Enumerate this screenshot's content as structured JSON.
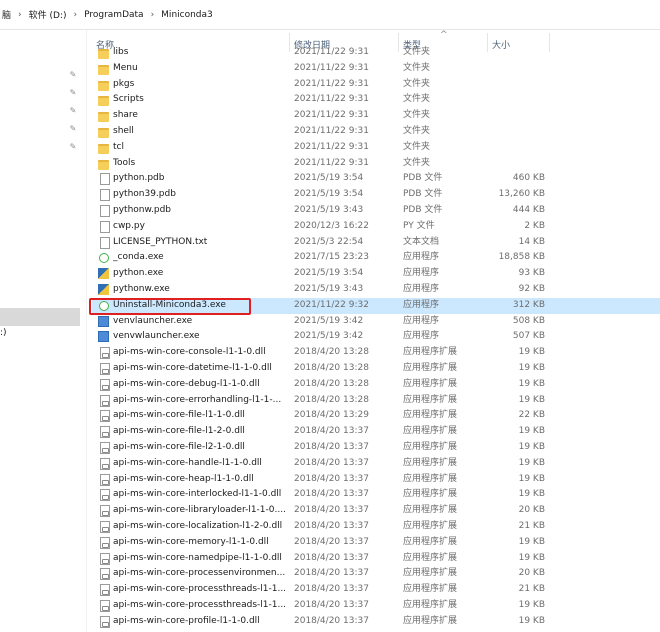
{
  "address": {
    "crumbs": [
      "脑",
      "软件 (D:)",
      "ProgramData",
      "Miniconda3"
    ]
  },
  "nav": {
    "drive_partial": ":)"
  },
  "columns": {
    "name": "名称",
    "date": "修改日期",
    "type": "类型",
    "size": "大小",
    "sort_indicator": "^"
  },
  "files": [
    {
      "name": "libs",
      "date": "2021/11/22 9:31",
      "type": "文件夹",
      "size": "",
      "icon": "folder-icon"
    },
    {
      "name": "Menu",
      "date": "2021/11/22 9:31",
      "type": "文件夹",
      "size": "",
      "icon": "folder-icon"
    },
    {
      "name": "pkgs",
      "date": "2021/11/22 9:31",
      "type": "文件夹",
      "size": "",
      "icon": "folder-icon"
    },
    {
      "name": "Scripts",
      "date": "2021/11/22 9:31",
      "type": "文件夹",
      "size": "",
      "icon": "folder-icon"
    },
    {
      "name": "share",
      "date": "2021/11/22 9:31",
      "type": "文件夹",
      "size": "",
      "icon": "folder-icon"
    },
    {
      "name": "shell",
      "date": "2021/11/22 9:31",
      "type": "文件夹",
      "size": "",
      "icon": "folder-icon"
    },
    {
      "name": "tcl",
      "date": "2021/11/22 9:31",
      "type": "文件夹",
      "size": "",
      "icon": "folder-icon"
    },
    {
      "name": "Tools",
      "date": "2021/11/22 9:31",
      "type": "文件夹",
      "size": "",
      "icon": "folder-icon"
    },
    {
      "name": "python.pdb",
      "date": "2021/5/19 3:54",
      "type": "PDB 文件",
      "size": "460 KB",
      "icon": "document-icon"
    },
    {
      "name": "python39.pdb",
      "date": "2021/5/19 3:54",
      "type": "PDB 文件",
      "size": "13,260 KB",
      "icon": "document-icon"
    },
    {
      "name": "pythonw.pdb",
      "date": "2021/5/19 3:43",
      "type": "PDB 文件",
      "size": "444 KB",
      "icon": "document-icon"
    },
    {
      "name": "cwp.py",
      "date": "2020/12/3 16:22",
      "type": "PY 文件",
      "size": "2 KB",
      "icon": "document-icon"
    },
    {
      "name": "LICENSE_PYTHON.txt",
      "date": "2021/5/3 22:54",
      "type": "文本文档",
      "size": "14 KB",
      "icon": "text-file-icon"
    },
    {
      "name": "_conda.exe",
      "date": "2021/7/15 23:23",
      "type": "应用程序",
      "size": "18,858 KB",
      "icon": "conda-icon"
    },
    {
      "name": "python.exe",
      "date": "2021/5/19 3:54",
      "type": "应用程序",
      "size": "93 KB",
      "icon": "python-icon"
    },
    {
      "name": "pythonw.exe",
      "date": "2021/5/19 3:43",
      "type": "应用程序",
      "size": "92 KB",
      "icon": "python-icon"
    },
    {
      "name": "Uninstall-Miniconda3.exe",
      "date": "2021/11/22 9:32",
      "type": "应用程序",
      "size": "312 KB",
      "icon": "conda-icon",
      "selected": true
    },
    {
      "name": "venvlauncher.exe",
      "date": "2021/5/19 3:42",
      "type": "应用程序",
      "size": "508 KB",
      "icon": "application-icon"
    },
    {
      "name": "venvwlauncher.exe",
      "date": "2021/5/19 3:42",
      "type": "应用程序",
      "size": "507 KB",
      "icon": "application-icon"
    },
    {
      "name": "api-ms-win-core-console-l1-1-0.dll",
      "date": "2018/4/20 13:28",
      "type": "应用程序扩展",
      "size": "19 KB",
      "icon": "dll-icon"
    },
    {
      "name": "api-ms-win-core-datetime-l1-1-0.dll",
      "date": "2018/4/20 13:28",
      "type": "应用程序扩展",
      "size": "19 KB",
      "icon": "dll-icon"
    },
    {
      "name": "api-ms-win-core-debug-l1-1-0.dll",
      "date": "2018/4/20 13:28",
      "type": "应用程序扩展",
      "size": "19 KB",
      "icon": "dll-icon"
    },
    {
      "name": "api-ms-win-core-errorhandling-l1-1-...",
      "date": "2018/4/20 13:28",
      "type": "应用程序扩展",
      "size": "19 KB",
      "icon": "dll-icon"
    },
    {
      "name": "api-ms-win-core-file-l1-1-0.dll",
      "date": "2018/4/20 13:29",
      "type": "应用程序扩展",
      "size": "22 KB",
      "icon": "dll-icon"
    },
    {
      "name": "api-ms-win-core-file-l1-2-0.dll",
      "date": "2018/4/20 13:37",
      "type": "应用程序扩展",
      "size": "19 KB",
      "icon": "dll-icon"
    },
    {
      "name": "api-ms-win-core-file-l2-1-0.dll",
      "date": "2018/4/20 13:37",
      "type": "应用程序扩展",
      "size": "19 KB",
      "icon": "dll-icon"
    },
    {
      "name": "api-ms-win-core-handle-l1-1-0.dll",
      "date": "2018/4/20 13:37",
      "type": "应用程序扩展",
      "size": "19 KB",
      "icon": "dll-icon"
    },
    {
      "name": "api-ms-win-core-heap-l1-1-0.dll",
      "date": "2018/4/20 13:37",
      "type": "应用程序扩展",
      "size": "19 KB",
      "icon": "dll-icon"
    },
    {
      "name": "api-ms-win-core-interlocked-l1-1-0.dll",
      "date": "2018/4/20 13:37",
      "type": "应用程序扩展",
      "size": "19 KB",
      "icon": "dll-icon"
    },
    {
      "name": "api-ms-win-core-libraryloader-l1-1-0....",
      "date": "2018/4/20 13:37",
      "type": "应用程序扩展",
      "size": "20 KB",
      "icon": "dll-icon"
    },
    {
      "name": "api-ms-win-core-localization-l1-2-0.dll",
      "date": "2018/4/20 13:37",
      "type": "应用程序扩展",
      "size": "21 KB",
      "icon": "dll-icon"
    },
    {
      "name": "api-ms-win-core-memory-l1-1-0.dll",
      "date": "2018/4/20 13:37",
      "type": "应用程序扩展",
      "size": "19 KB",
      "icon": "dll-icon"
    },
    {
      "name": "api-ms-win-core-namedpipe-l1-1-0.dll",
      "date": "2018/4/20 13:37",
      "type": "应用程序扩展",
      "size": "19 KB",
      "icon": "dll-icon"
    },
    {
      "name": "api-ms-win-core-processenvironmen...",
      "date": "2018/4/20 13:37",
      "type": "应用程序扩展",
      "size": "20 KB",
      "icon": "dll-icon"
    },
    {
      "name": "api-ms-win-core-processthreads-l1-1...",
      "date": "2018/4/20 13:37",
      "type": "应用程序扩展",
      "size": "21 KB",
      "icon": "dll-icon"
    },
    {
      "name": "api-ms-win-core-processthreads-l1-1...",
      "date": "2018/4/20 13:37",
      "type": "应用程序扩展",
      "size": "19 KB",
      "icon": "dll-icon"
    },
    {
      "name": "api-ms-win-core-profile-l1-1-0.dll",
      "date": "2018/4/20 13:37",
      "type": "应用程序扩展",
      "size": "19 KB",
      "icon": "dll-icon"
    }
  ],
  "colors": {
    "selection": "#cce8ff",
    "highlight_border": "#e02020"
  }
}
